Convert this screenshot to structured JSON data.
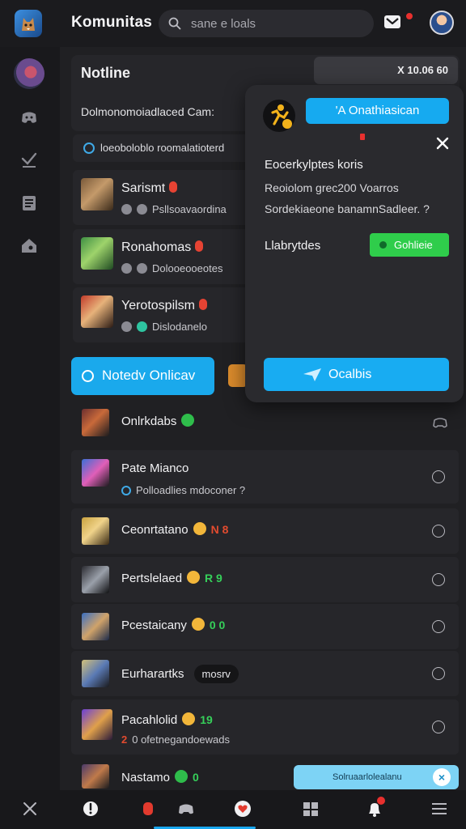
{
  "app": {
    "title": "Komunitas"
  },
  "search": {
    "placeholder": "sane e loals"
  },
  "header": {
    "notline_title": "Notline",
    "notline_badge": "X 10.06 60",
    "notline_subtitle": "Dolmonomoiadlaced Cam:"
  },
  "filter": {
    "text": "loeoboloblo roomalatioterd"
  },
  "friends": [
    {
      "name": "Sarismt",
      "status": "Psllsoavaordina"
    },
    {
      "name": "Ronahomas",
      "status": "Dolooeooeotes"
    },
    {
      "name": "Yerotospilsm",
      "status": "Dislodanelo"
    }
  ],
  "online_button": {
    "label": "Notedv Onlicav"
  },
  "rows": [
    {
      "name": "Onlrkdabs",
      "sub": "",
      "status": "",
      "status_color": "",
      "pill": ""
    },
    {
      "name": "Pate Mianco",
      "sub": "Polloadlies mdoconer ?",
      "status": "",
      "status_color": "",
      "pill": ""
    },
    {
      "name": "Ceonrtatano",
      "sub": "",
      "status": "N 8",
      "status_color": "red",
      "pill": ""
    },
    {
      "name": "Pertslelaed",
      "sub": "",
      "status": "R 9",
      "status_color": "green",
      "pill": ""
    },
    {
      "name": "Pcestaicany",
      "sub": "",
      "status": "0 0",
      "status_color": "green",
      "pill": ""
    },
    {
      "name": "Eurharartks",
      "sub": "",
      "status": "",
      "status_color": "",
      "pill": "mosrv"
    },
    {
      "name": "Pacahlolid",
      "sub": "0 ofetnegandoewads",
      "status": "19",
      "status_color": "green",
      "pill": ""
    },
    {
      "name": "Nastamo",
      "sub": "",
      "status": "0",
      "status_color": "green",
      "pill": ""
    }
  ],
  "bottom_pill": {
    "label": "Solruaarlolealanu"
  },
  "popover": {
    "cta_label": "'A Onathiasican",
    "heading": "Eocerkylptes koris",
    "line1": "Reoiolom grec200 Voarros",
    "line2": "Sordekiaeone banamnSadleer. ?",
    "label": "Llabrytdes",
    "badge": "Gohlieie",
    "main_button": "Ocalbis"
  },
  "colors": {
    "accent": "#18acf2",
    "success": "#2fcd4b",
    "danger": "#e8302e",
    "panel": "#26262a",
    "background": "#202023"
  },
  "icons": {
    "rail": [
      "discord-icon",
      "check-icon",
      "list-icon",
      "home-icon"
    ],
    "bottom_nav": [
      "close-icon",
      "alert-icon",
      "red-badge-icon",
      "gamepad-icon",
      "heart-icon",
      "grid-icon",
      "bell-icon",
      "menu-icon"
    ]
  }
}
